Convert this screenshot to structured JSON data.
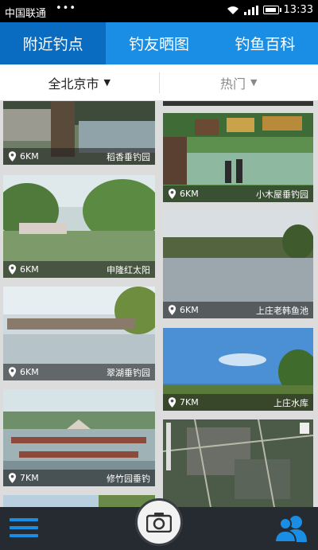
{
  "status_bar": {
    "carrier": "中国联通",
    "dots": "•••",
    "time": "13:33"
  },
  "tabs": [
    {
      "label": "附近钓点",
      "active": true
    },
    {
      "label": "钓友晒图",
      "active": false
    },
    {
      "label": "钓鱼百科",
      "active": false
    }
  ],
  "filters": {
    "region": "全北京市",
    "sort": "热门"
  },
  "feed": {
    "left": [
      {
        "distance": "6KM",
        "name": "稻香垂钓园"
      },
      {
        "distance": "6KM",
        "name": "申隆红太阳"
      },
      {
        "distance": "6KM",
        "name": "翠湖垂钓园"
      },
      {
        "distance": "7KM",
        "name": "修竹园垂钓"
      }
    ],
    "right": [
      {
        "distance": "6KM",
        "name": "小木屋垂钓园"
      },
      {
        "distance": "6KM",
        "name": "上庄老韩鱼池"
      },
      {
        "distance": "7KM",
        "name": "上庄水库"
      }
    ]
  },
  "colors": {
    "accent": "#1a8ee4",
    "tab_active": "#0a6cc0",
    "bottom_bar": "#262b31"
  },
  "icons": {
    "menu": "menu-icon",
    "camera": "camera-icon",
    "friends": "friends-icon",
    "location": "location-pin-icon"
  }
}
